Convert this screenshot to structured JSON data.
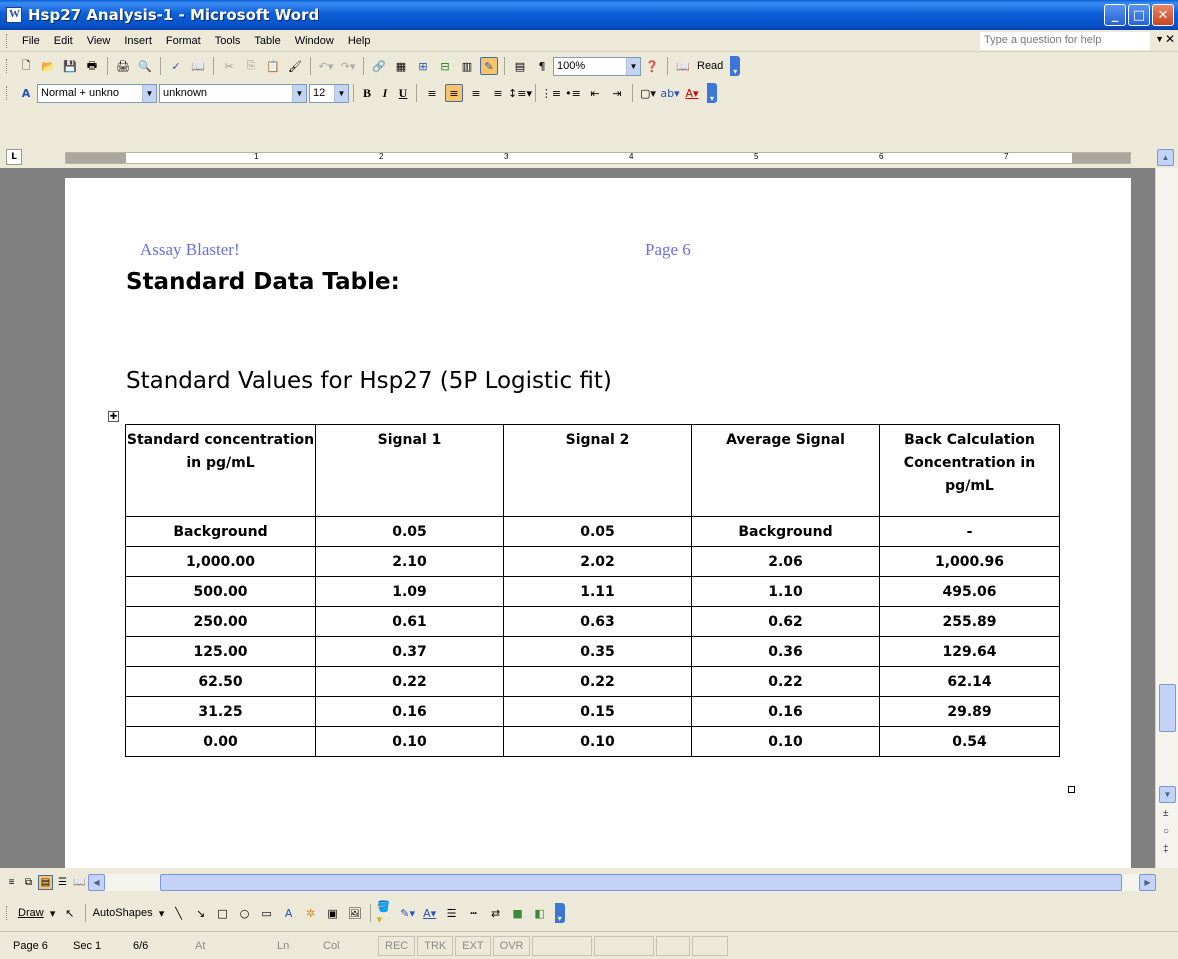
{
  "window": {
    "title": "Hsp27 Analysis-1 - Microsoft Word"
  },
  "menu": {
    "items": [
      "File",
      "Edit",
      "View",
      "Insert",
      "Format",
      "Tools",
      "Table",
      "Window",
      "Help"
    ],
    "help_placeholder": "Type a question for help"
  },
  "standard_toolbar": {
    "zoom": "100%",
    "read_label": "Read"
  },
  "format_toolbar": {
    "style": "Normal + unkno",
    "font": "unknown",
    "size": "12"
  },
  "ruler": {
    "numbers": [
      "1",
      "2",
      "3",
      "4",
      "5",
      "6",
      "7"
    ]
  },
  "document": {
    "header_left": "Assay Blaster!",
    "header_right": "Page 6",
    "title": "Standard Data Table:",
    "subtitle": "Standard Values for Hsp27  (5P Logistic fit)",
    "table": {
      "headers": [
        "Standard concentration in pg/mL",
        "Signal 1",
        "Signal 2",
        "Average Signal",
        "Back Calculation Concentration in pg/mL"
      ],
      "rows": [
        [
          "Background",
          "0.05",
          "0.05",
          "Background",
          "-"
        ],
        [
          "1,000.00",
          "2.10",
          "2.02",
          "2.06",
          "1,000.96"
        ],
        [
          "500.00",
          "1.09",
          "1.11",
          "1.10",
          "495.06"
        ],
        [
          "250.00",
          "0.61",
          "0.63",
          "0.62",
          "255.89"
        ],
        [
          "125.00",
          "0.37",
          "0.35",
          "0.36",
          "129.64"
        ],
        [
          "62.50",
          "0.22",
          "0.22",
          "0.22",
          "62.14"
        ],
        [
          "31.25",
          "0.16",
          "0.15",
          "0.16",
          "29.89"
        ],
        [
          "0.00",
          "0.10",
          "0.10",
          "0.10",
          "0.54"
        ]
      ]
    }
  },
  "drawing_toolbar": {
    "draw": "Draw",
    "autoshapes": "AutoShapes"
  },
  "status": {
    "page": "Page 6",
    "sec": "Sec 1",
    "pages": "6/6",
    "at": "At",
    "ln": "Ln",
    "col": "Col",
    "rec": "REC",
    "trk": "TRK",
    "ext": "EXT",
    "ovr": "OVR"
  }
}
